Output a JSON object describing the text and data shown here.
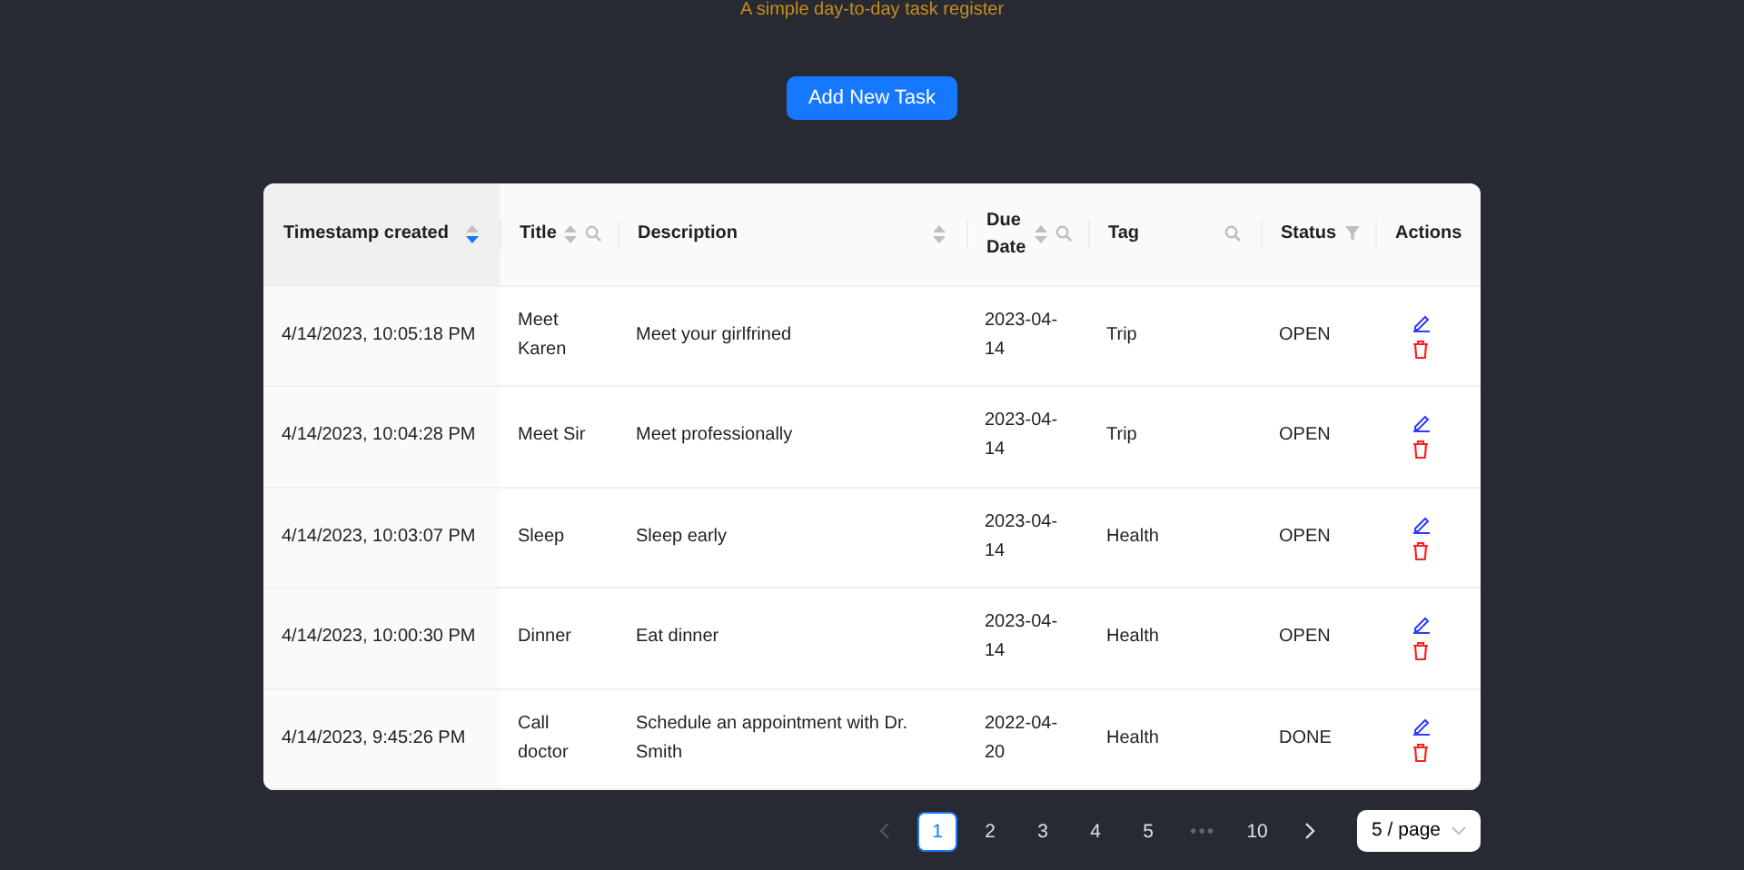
{
  "subtitle": "A simple day-to-day task register",
  "add_button": "Add New Task",
  "table": {
    "columns": [
      {
        "label": "Timestamp created",
        "sortable": true,
        "sorted": true,
        "search": false,
        "filter": false
      },
      {
        "label": "Title",
        "sortable": true,
        "sorted": false,
        "search": true,
        "filter": false
      },
      {
        "label": "Description",
        "sortable": true,
        "sorted": false,
        "search": false,
        "filter": false
      },
      {
        "label": "Due Date",
        "sortable": true,
        "sorted": false,
        "search": true,
        "filter": false
      },
      {
        "label": "Tag",
        "sortable": false,
        "search": true,
        "filter": false
      },
      {
        "label": "Status",
        "sortable": false,
        "search": false,
        "filter": true
      },
      {
        "label": "Actions",
        "sortable": false,
        "search": false,
        "filter": false
      }
    ],
    "rows": [
      {
        "timestamp": "4/14/2023, 10:05:18 PM",
        "title": "Meet Karen",
        "description": "Meet your girlfrined",
        "due_date": "2023-04-14",
        "tag": "Trip",
        "status": "OPEN"
      },
      {
        "timestamp": "4/14/2023, 10:04:28 PM",
        "title": "Meet Sir",
        "description": "Meet professionally",
        "due_date": "2023-04-14",
        "tag": "Trip",
        "status": "OPEN"
      },
      {
        "timestamp": "4/14/2023, 10:03:07 PM",
        "title": "Sleep",
        "description": "Sleep early",
        "due_date": "2023-04-14",
        "tag": "Health",
        "status": "OPEN"
      },
      {
        "timestamp": "4/14/2023, 10:00:30 PM",
        "title": "Dinner",
        "description": "Eat dinner",
        "due_date": "2023-04-14",
        "tag": "Health",
        "status": "OPEN"
      },
      {
        "timestamp": "4/14/2023, 9:45:26 PM",
        "title": "Call doctor",
        "description": "Schedule an appointment with Dr. Smith",
        "due_date": "2022-04-20",
        "tag": "Health",
        "status": "DONE"
      }
    ]
  },
  "pagination": {
    "prev_disabled": true,
    "next_disabled": false,
    "items": [
      {
        "kind": "page",
        "label": "1",
        "selected": true
      },
      {
        "kind": "page",
        "label": "2",
        "selected": false
      },
      {
        "kind": "page",
        "label": "3",
        "selected": false
      },
      {
        "kind": "page",
        "label": "4",
        "selected": false
      },
      {
        "kind": "page",
        "label": "5",
        "selected": false
      },
      {
        "kind": "ellipsis",
        "label": "•••"
      },
      {
        "kind": "page",
        "label": "10",
        "selected": false
      }
    ],
    "page_size": "5 / page"
  }
}
